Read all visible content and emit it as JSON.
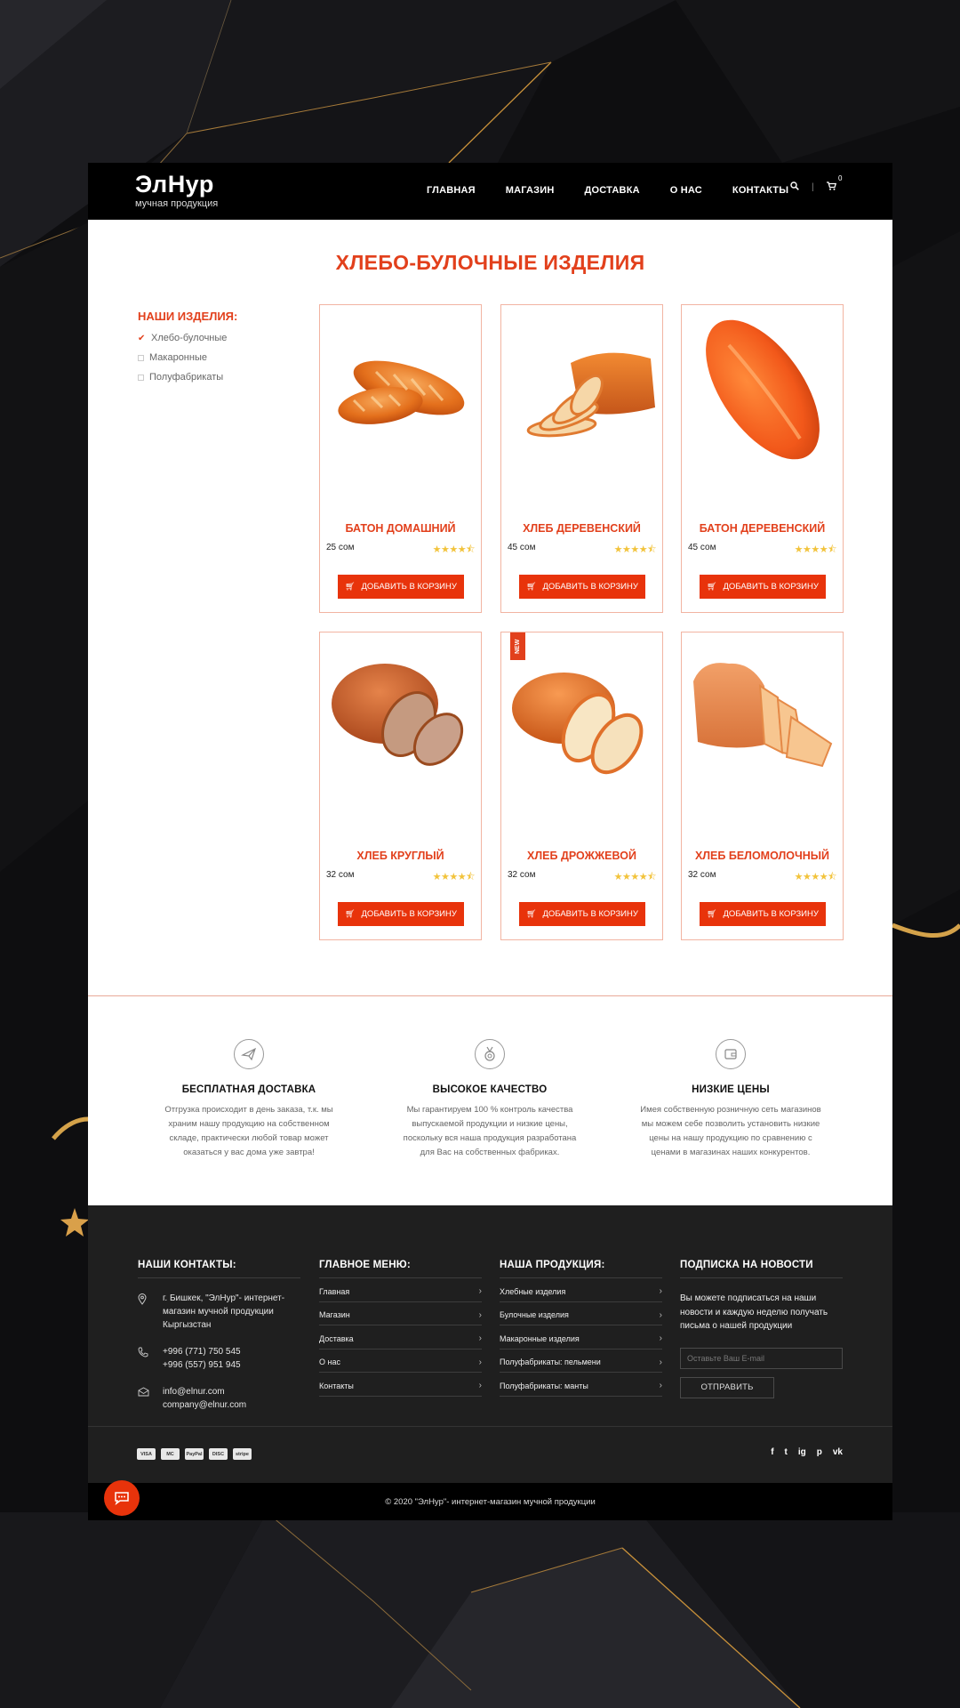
{
  "header": {
    "logo_name": "ЭлНур",
    "logo_sub": "мучная продукция",
    "nav": [
      "ГЛАВНАЯ",
      "МАГАЗИН",
      "ДОСТАВКА",
      "О НАС",
      "КОНТАКТЫ"
    ],
    "cart_count": "0"
  },
  "main": {
    "title": "ХЛЕБО-БУЛОЧНЫЕ ИЗДЕЛИЯ",
    "sidebar": {
      "heading": "НАШИ ИЗДЕЛИЯ:",
      "categories": [
        {
          "label": "Хлебо-булочные",
          "checked": true
        },
        {
          "label": "Макаронные",
          "checked": false
        },
        {
          "label": "Полуфабрикаты",
          "checked": false
        }
      ]
    },
    "add_to_cart_label": "ДОБАВИТЬ В КОРЗИНУ",
    "new_badge": "NEW",
    "products": [
      {
        "name": "БАТОН ДОМАШНИЙ",
        "price": "25 сом",
        "rating": 4.5
      },
      {
        "name": "ХЛЕБ ДЕРЕВЕНСКИЙ",
        "price": "45 сом",
        "rating": 4.5
      },
      {
        "name": "БАТОН ДЕРЕВЕНСКИЙ",
        "price": "45 сом",
        "rating": 4.5
      },
      {
        "name": "ХЛЕБ КРУГЛЫЙ",
        "price": "32 сом",
        "rating": 4.5
      },
      {
        "name": "ХЛЕБ ДРОЖЖЕВОЙ",
        "price": "32 сом",
        "rating": 4.5
      },
      {
        "name": "ХЛЕБ БЕЛОМОЛОЧНЫЙ",
        "price": "32 сом",
        "rating": 4.5
      }
    ]
  },
  "features": [
    {
      "icon": "plane-icon",
      "title": "БЕСПЛАТНАЯ ДОСТАВКА",
      "text": "Отгрузка происходит в день заказа, т.к. мы храним нашу продукцию на собственном складе, практически любой товар может оказаться у вас дома уже завтра!"
    },
    {
      "icon": "medal-icon",
      "title": "ВЫСОКОЕ КАЧЕСТВО",
      "text": "Мы гарантируем 100 % контроль качества выпускаемой продукции и низкие цены, поскольку вся наша продукция разработана для Вас на собственных фабриках."
    },
    {
      "icon": "wallet-icon",
      "title": "НИЗКИЕ ЦЕНЫ",
      "text": "Имея собственную розничную сеть магазинов мы можем себе позволить установить низкие цены на нашу продукцию по сравнению с ценами в магазинах наших конкурентов."
    }
  ],
  "footer": {
    "contacts": {
      "heading": "НАШИ КОНТАКТЫ:",
      "address": [
        "г. Бишкек, \"ЭлНур\"- интернет-",
        "магазин мучной продукции",
        "Кыргызстан"
      ],
      "phones": [
        "+996 (771) 750 545",
        "+996 (557) 951 945"
      ],
      "emails": [
        "info@elnur.com",
        "company@elnur.com"
      ]
    },
    "menu": {
      "heading": "ГЛАВНОЕ МЕНЮ:",
      "links": [
        "Главная",
        "Магазин",
        "Доставка",
        "О нас",
        "Контакты"
      ]
    },
    "products": {
      "heading": "НАША ПРОДУКЦИЯ:",
      "links": [
        "Хлебные изделия",
        "Булочные изделия",
        "Макаронные изделия",
        "Полуфабрикаты: пельмени",
        "Полуфабрикаты: манты"
      ]
    },
    "newsletter": {
      "heading": "ПОДПИСКА НА НОВОСТИ",
      "text": "Вы можете подписаться на наши новости и каждую неделю получать письма о нашей продукции",
      "placeholder": "Оставьте Ваш E-mail",
      "button": "ОТПРАВИТЬ"
    },
    "payments": [
      "VISA",
      "MC",
      "PayPal",
      "DISC",
      "stripe"
    ],
    "social": [
      "f",
      "t",
      "ig",
      "p",
      "vk"
    ],
    "copyright": "© 2020 \"ЭлНур\"- интернет-магазин мучной продукции"
  }
}
